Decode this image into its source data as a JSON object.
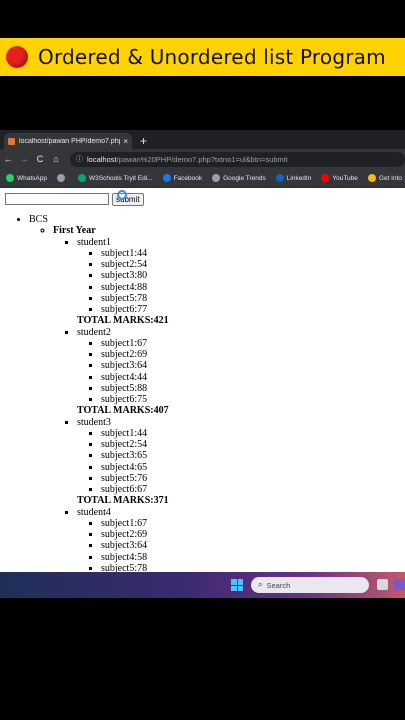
{
  "banner": {
    "title": "Ordered & Unordered list  Program",
    "dot_color": "#e8211c"
  },
  "browser": {
    "tab": {
      "title": "localhost/pawan PHP/demo7.php",
      "close": "×",
      "new_tab": "+"
    },
    "nav": {
      "back": "←",
      "forward": "→",
      "reload": "C",
      "home": "⌂"
    },
    "url": {
      "host": "localhost",
      "path": "/pawan%20PHP/demo7.php?txtno1=ul&btn=submit"
    },
    "bookmarks": [
      {
        "label": "WhatsApp",
        "icon": "whatsapp-icon",
        "color": "#25d366"
      },
      {
        "label": "",
        "icon": "globe-icon",
        "color": "#9aa0a6"
      },
      {
        "label": "W3Schools Tryit Edi...",
        "icon": "w3schools-icon",
        "color": "#04aa6d"
      },
      {
        "label": "Facebook",
        "icon": "facebook-icon",
        "color": "#1877f2"
      },
      {
        "label": "Google Trends",
        "icon": "globe-icon",
        "color": "#9aa0a6"
      },
      {
        "label": "LinkedIn",
        "icon": "linkedin-icon",
        "color": "#0a66c2"
      },
      {
        "label": "YouTube",
        "icon": "youtube-icon",
        "color": "#ff0000"
      },
      {
        "label": "Get Into",
        "icon": "google-icon",
        "color": "#fbbc05"
      }
    ]
  },
  "form": {
    "input_value": "",
    "submit_label": "submit"
  },
  "tree": {
    "course": "BCS",
    "year": "First Year",
    "students": [
      {
        "name": "student1",
        "subjects": [
          "subject1:44",
          "subject2:54",
          "subject3:80",
          "subject4:88",
          "subject5:78",
          "subject6:77"
        ],
        "total": "TOTAL MARKS:421"
      },
      {
        "name": "student2",
        "subjects": [
          "subject1:67",
          "subject2:69",
          "subject3:64",
          "subject4:44",
          "subject5:88",
          "subject6:75"
        ],
        "total": "TOTAL MARKS:407"
      },
      {
        "name": "student3",
        "subjects": [
          "subject1:44",
          "subject2:54",
          "subject3:65",
          "subject4:65",
          "subject5:76",
          "subject6:67"
        ],
        "total": "TOTAL MARKS:371"
      },
      {
        "name": "student4",
        "subjects": [
          "subject1:67",
          "subject2:69",
          "subject3:64",
          "subject4:58",
          "subject5:78"
        ],
        "total": ""
      }
    ]
  },
  "taskbar": {
    "search_placeholder": "Search"
  }
}
